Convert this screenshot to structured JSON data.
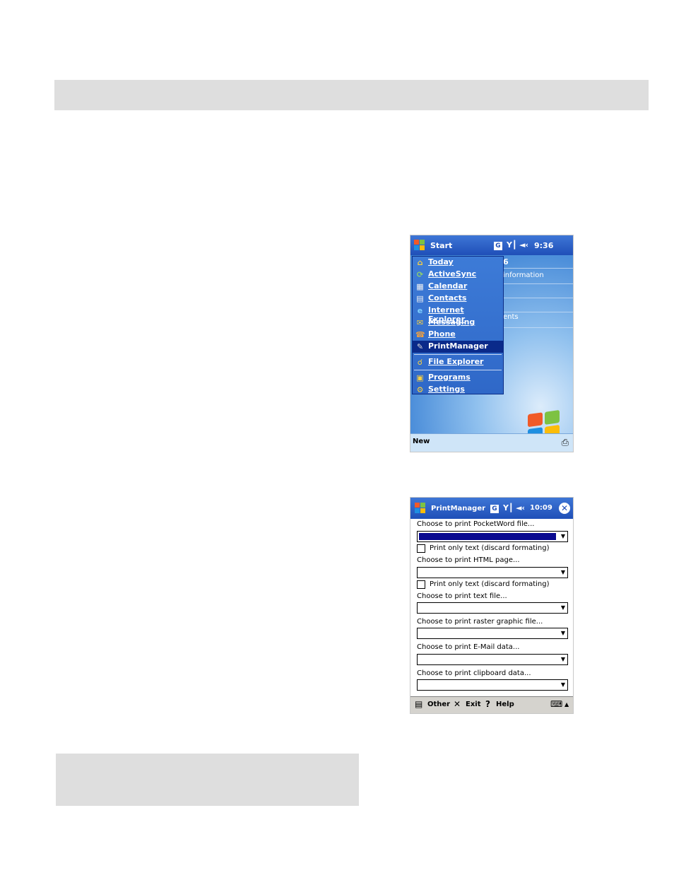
{
  "screen1": {
    "title": "Start",
    "indicator": "G",
    "time": "9:36",
    "peek_texts": [
      "6",
      "information",
      "ents"
    ],
    "menu_items": [
      {
        "label": "Today",
        "icon": "today-icon"
      },
      {
        "label": "ActiveSync",
        "icon": "activesync-icon"
      },
      {
        "label": "Calendar",
        "icon": "calendar-icon"
      },
      {
        "label": "Contacts",
        "icon": "contacts-icon"
      },
      {
        "label": "Internet Explorer",
        "icon": "internet-explorer-icon"
      },
      {
        "label": "Messaging",
        "icon": "messaging-icon"
      },
      {
        "label": "Phone",
        "icon": "phone-icon"
      },
      {
        "label": "PrintManager",
        "icon": "printmanager-icon",
        "selected": true
      },
      {
        "label": "File Explorer",
        "icon": "file-explorer-icon"
      },
      {
        "label": "Programs",
        "icon": "programs-icon"
      },
      {
        "label": "Settings",
        "icon": "settings-icon"
      }
    ],
    "bottom_left": "New"
  },
  "screen2": {
    "title": "PrintManager",
    "indicator": "G",
    "time": "10:09",
    "labels": {
      "pocketword": "Choose to print PocketWord file...",
      "html": "Choose to print HTML page...",
      "text": "Choose to print text file...",
      "raster": "Choose to print raster graphic file...",
      "email": "Choose to print E-Mail data...",
      "clipboard": "Choose to print clipboard data..."
    },
    "checkbox_label": "Print only text (discard formating)",
    "toolbar": {
      "other": "Other",
      "exit": "Exit",
      "help": "Help"
    }
  }
}
